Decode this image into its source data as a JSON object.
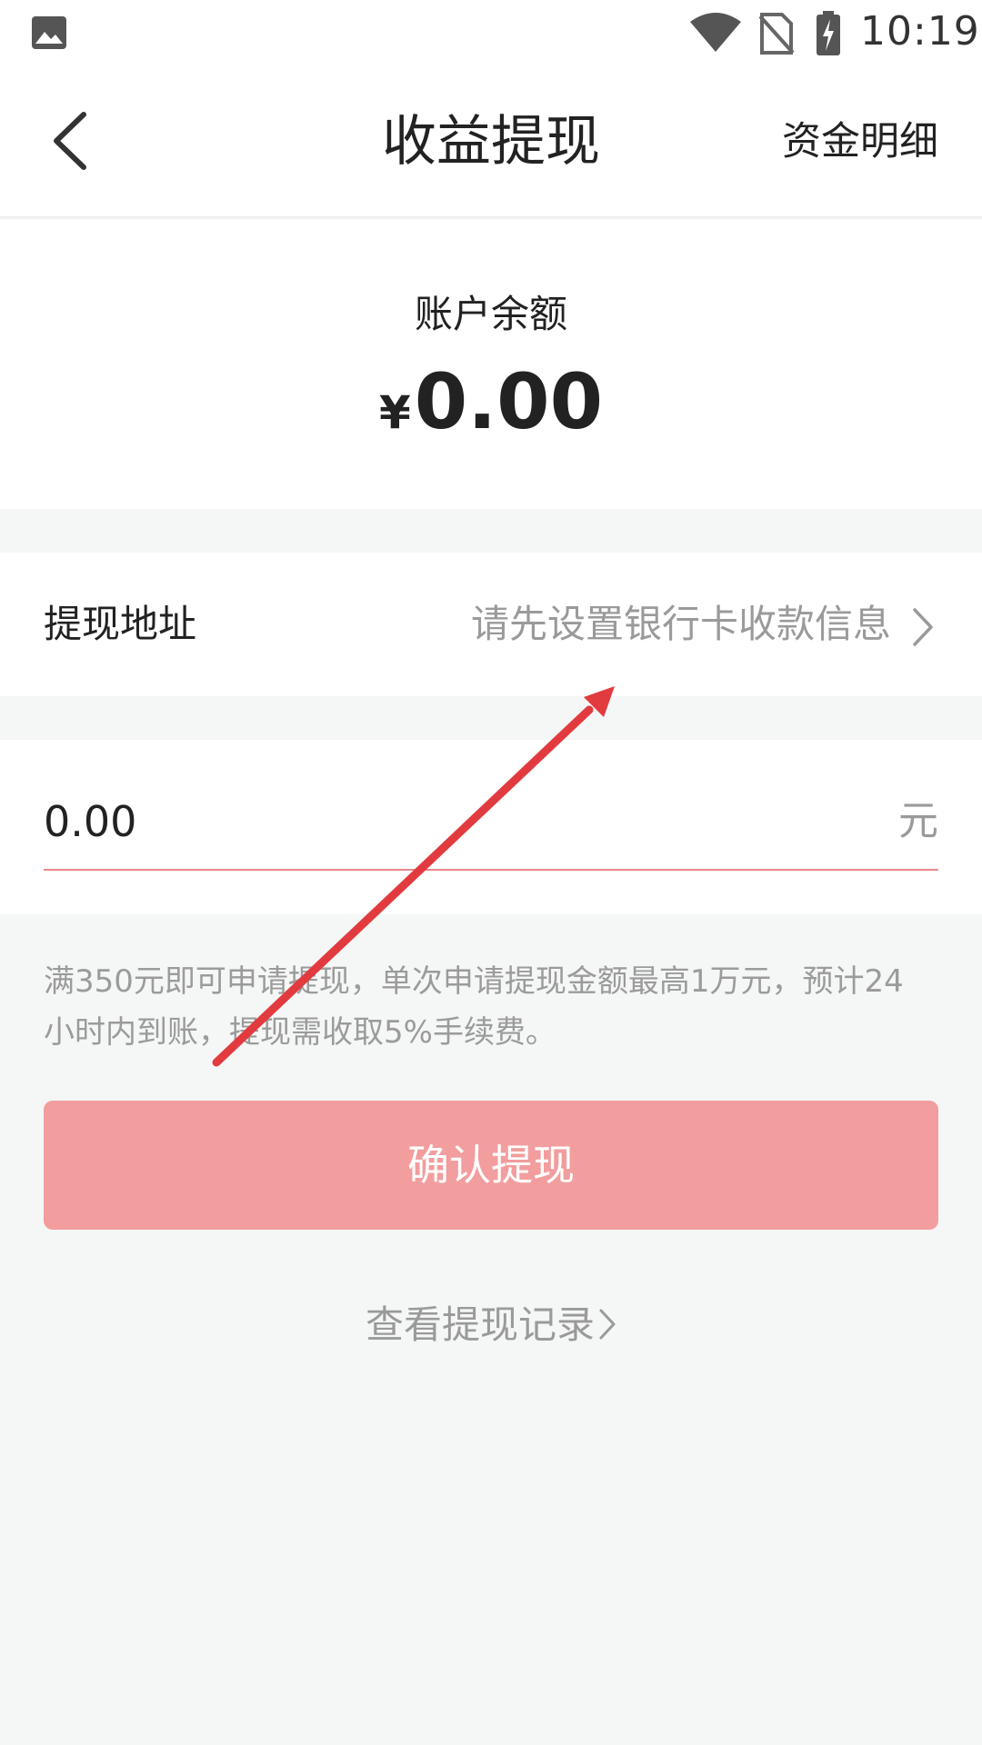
{
  "status_bar": {
    "time": "10:19",
    "icons": [
      "gallery-icon",
      "wifi-icon",
      "no-sim-icon",
      "battery-charging-icon"
    ]
  },
  "nav": {
    "back_icon": "chevron-left-icon",
    "title": "收益提现",
    "detail_link": "资金明细"
  },
  "balance": {
    "label": "账户余额",
    "currency": "¥",
    "amount": "0.00"
  },
  "address": {
    "label": "提现地址",
    "hint": "请先设置银行卡收款信息",
    "icon": "chevron-right-icon"
  },
  "amount_input": {
    "value": "0.00",
    "unit": "元"
  },
  "notice": "满350元即可申请提现，单次申请提现金额最高1万元，预计24小时内到账，提现需收取5%手续费。",
  "confirm_button": "确认提现",
  "records_link": "查看提现记录",
  "colors": {
    "accent_line": "#e9888c",
    "button_bg": "#f29d9e",
    "annotation_arrow": "#e23b3f",
    "page_bg": "#f5f6f6"
  }
}
